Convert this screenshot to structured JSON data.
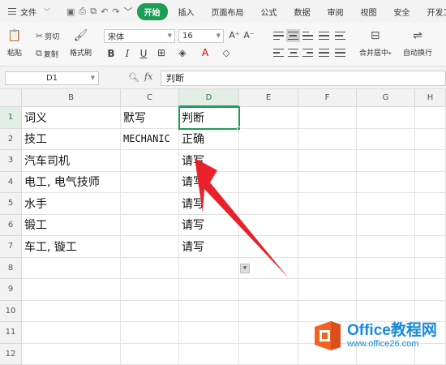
{
  "menubar": {
    "file": "文件",
    "active_tab": "开始",
    "tabs": [
      "插入",
      "页面布局",
      "公式",
      "数据",
      "审阅",
      "视图",
      "安全",
      "开发工"
    ]
  },
  "ribbon": {
    "paste": "粘贴",
    "cut": "剪切",
    "copy": "复制",
    "format_painter": "格式刷",
    "font_name": "宋体",
    "font_size": "16",
    "bold": "B",
    "italic": "I",
    "underline": "U",
    "merge_center": "合并居中",
    "wrap_text": "自动换行"
  },
  "formula_bar": {
    "cell_ref": "D1",
    "fx": "fx",
    "content": "判断"
  },
  "sheet": {
    "columns": [
      "B",
      "C",
      "D",
      "E",
      "F",
      "G",
      "H"
    ],
    "rows": [
      "1",
      "2",
      "3",
      "4",
      "5",
      "6",
      "7",
      "8",
      "9",
      "10",
      "11",
      "12"
    ],
    "cells": {
      "B1": "词义",
      "C1": "默写",
      "D1": "判断",
      "B2": "技工",
      "C2": "MECHANIC",
      "D2": "正确",
      "B3": "汽车司机",
      "D3": "请写",
      "B4": "电工, 电气技师",
      "D4": "请写",
      "B5": "水手",
      "D5": "请写",
      "B6": "锻工",
      "D6": "请写",
      "B7": "车工, 镟工",
      "D7": "请写"
    }
  },
  "watermark": {
    "title": "Office教程网",
    "url": "www.office26.com"
  },
  "colors": {
    "accent": "#1e9e55",
    "arrow": "#e8212a",
    "watermark": "#1a8ad8",
    "logo": "#f26322"
  }
}
